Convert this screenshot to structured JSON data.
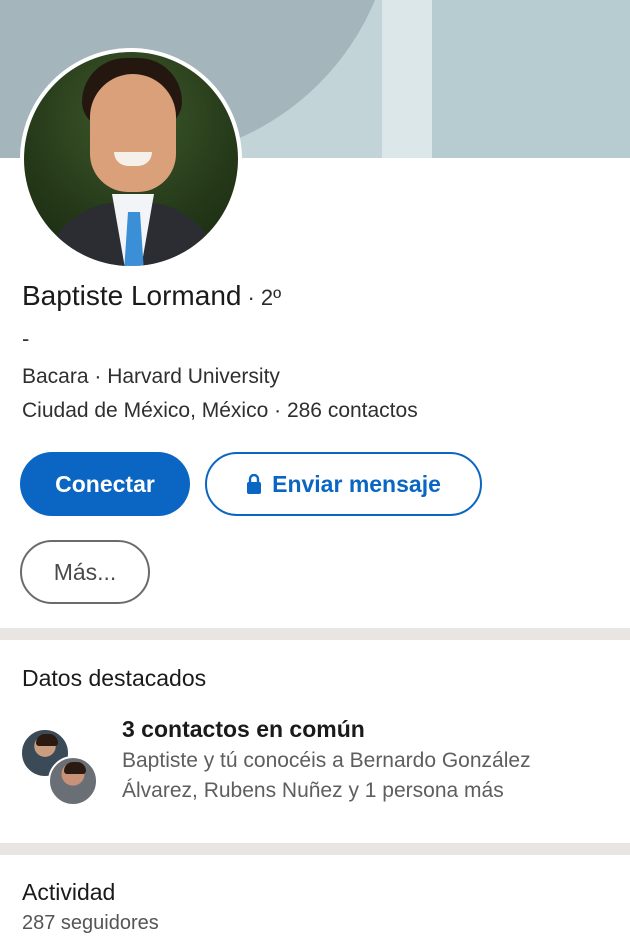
{
  "profile": {
    "name": "Baptiste Lormand",
    "degree": "· 2º",
    "headline": "-",
    "line1": "Bacara · Harvard University",
    "line2": "Ciudad de México, México · 286 contactos"
  },
  "actions": {
    "connect": "Conectar",
    "message": "Enviar mensaje",
    "more": "Más..."
  },
  "highlights": {
    "title": "Datos destacados",
    "common_title": "3 contactos en común",
    "common_desc_line1": "Baptiste y tú conocéis a Bernardo González",
    "common_desc_line2": "Álvarez, Rubens Nuñez y 1 persona más"
  },
  "activity": {
    "title": "Actividad",
    "followers": "287 seguidores"
  },
  "colors": {
    "accent": "#0a66c2",
    "banner": "#c3d4d8",
    "divider": "#e8e5e2"
  },
  "icons": {
    "message_button": "lock-icon"
  }
}
